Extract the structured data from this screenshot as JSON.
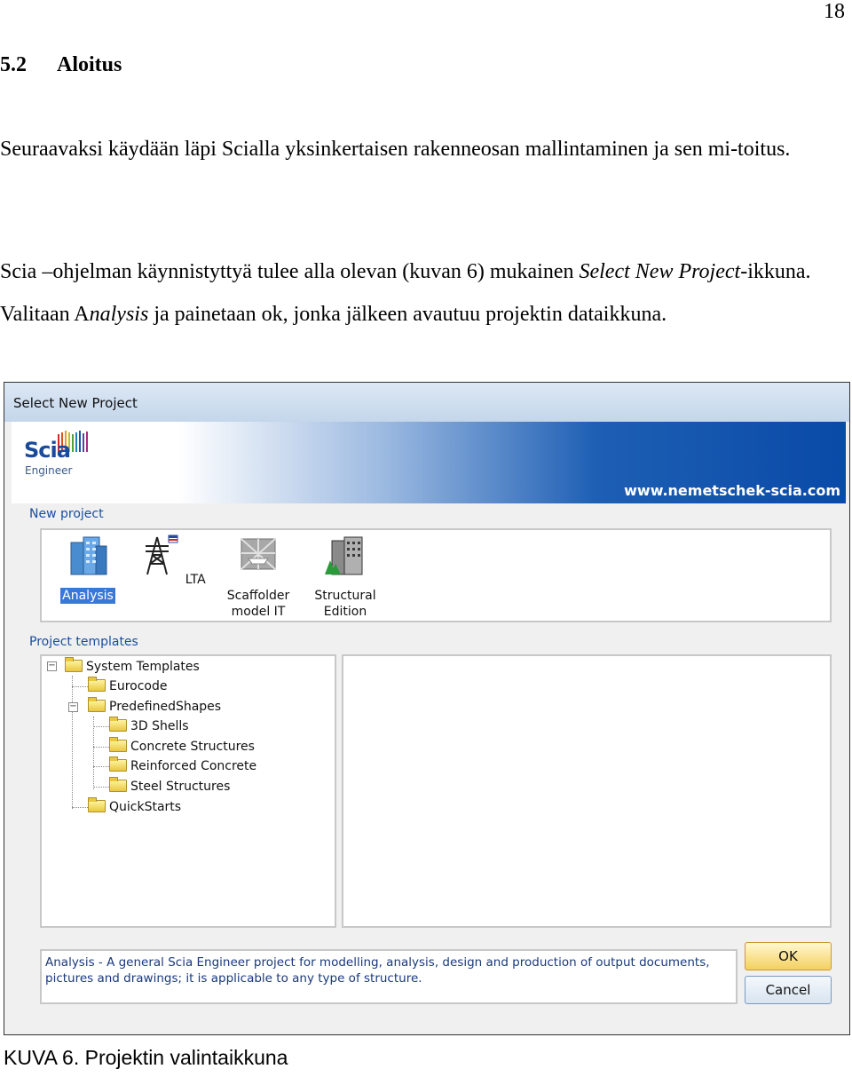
{
  "page_number": "18",
  "section": {
    "number": "5.2",
    "title": "Aloitus"
  },
  "paragraph1": "Seuraavaksi käydään läpi Scialla yksinkertaisen rakenneosan mallintaminen ja sen mi-toitus.",
  "paragraph2": {
    "before": "Scia –ohjelman käynnistyttyä tulee alla olevan (kuvan 6) mukainen ",
    "italic1": "Select New Project",
    "middle": "-ikkuna. Valitaan A",
    "italic2": "nalysis",
    "after": " ja painetaan ok, jonka jälkeen avautuu projektin dataikkuna."
  },
  "dialog": {
    "title": "Select New Project",
    "logo_name": "Scia",
    "logo_sub": "Engineer",
    "url": "www.nemetschek-scia.com",
    "new_project_label": "New project",
    "project_types": [
      {
        "line1": "Analysis",
        "line2": "",
        "icon": "building-icon",
        "selected": true
      },
      {
        "line1": "LTA",
        "line2": "",
        "icon": "pylon-icon",
        "selected": false
      },
      {
        "line1": "Scaffolder",
        "line2": "model IT",
        "icon": "scaffold-icon",
        "selected": false
      },
      {
        "line1": "Structural",
        "line2": "Edition",
        "icon": "city-icon",
        "selected": false
      }
    ],
    "templates_label": "Project templates",
    "tree": [
      "System Templates",
      "Eurocode",
      "PredefinedShapes",
      "3D Shells",
      "Concrete Structures",
      "Reinforced Concrete",
      "Steel Structures",
      "QuickStarts"
    ],
    "description": "Analysis - A general Scia Engineer project for modelling, analysis, design and production of output documents, pictures and drawings; it is applicable to any type of structure.",
    "ok_label": "OK",
    "cancel_label": "Cancel"
  },
  "caption": "KUVA 6. Projektin valintaikkuna"
}
